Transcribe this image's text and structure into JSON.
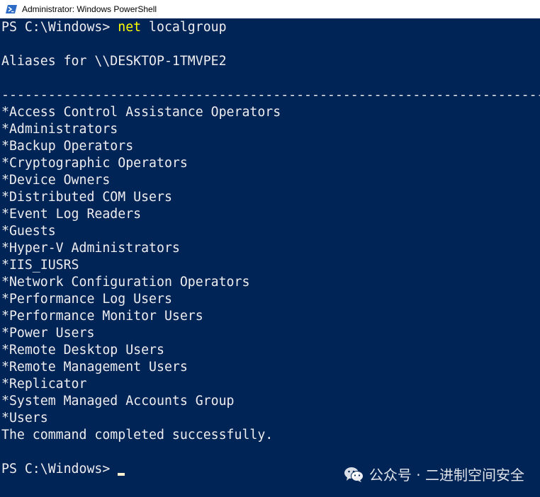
{
  "window": {
    "title": "Administrator: Windows PowerShell"
  },
  "console": {
    "prompt1": "PS C:\\Windows> ",
    "command": "net",
    "command_args": " localgroup",
    "aliases_header": "Aliases for \\\\DESKTOP-1TMVPE2",
    "separator": "-------------------------------------------------------------------------------",
    "groups": [
      "*Access Control Assistance Operators",
      "*Administrators",
      "*Backup Operators",
      "*Cryptographic Operators",
      "*Device Owners",
      "*Distributed COM Users",
      "*Event Log Readers",
      "*Guests",
      "*Hyper-V Administrators",
      "*IIS_IUSRS",
      "*Network Configuration Operators",
      "*Performance Log Users",
      "*Performance Monitor Users",
      "*Power Users",
      "*Remote Desktop Users",
      "*Remote Management Users",
      "*Replicator",
      "*System Managed Accounts Group",
      "*Users"
    ],
    "completion": "The command completed successfully.",
    "prompt2": "PS C:\\Windows> "
  },
  "watermark": {
    "text": "公众号 · 二进制空间安全",
    "icon": "wechat-icon"
  },
  "colors": {
    "background": "#012456",
    "text": "#eeedf0",
    "command": "#ffff00",
    "cursor": "#fdf3d0"
  }
}
